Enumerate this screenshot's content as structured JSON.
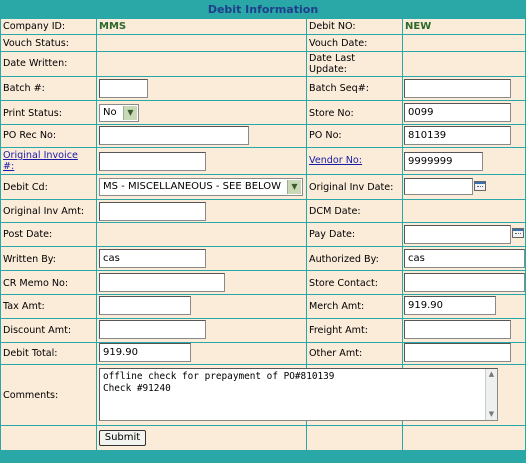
{
  "title": "Debit Information",
  "fields": {
    "company_id": {
      "label": "Company ID:",
      "value": "MMS"
    },
    "debit_no": {
      "label": "Debit NO:",
      "value": "NEW"
    },
    "vouch_status": {
      "label": "Vouch Status:"
    },
    "vouch_date": {
      "label": "Vouch Date:"
    },
    "date_written": {
      "label": "Date Written:"
    },
    "date_last_update": {
      "label_line1": "Date Last",
      "label_line2": "Update:"
    },
    "batch": {
      "label": "Batch #:",
      "value": ""
    },
    "batch_seq": {
      "label": "Batch Seq#:",
      "value": ""
    },
    "print_status": {
      "label": "Print Status:",
      "value": "No"
    },
    "store_no": {
      "label": "Store No:",
      "value": "0099"
    },
    "po_rec_no": {
      "label": "PO Rec No:",
      "value": ""
    },
    "po_no": {
      "label": "PO No:",
      "value": "810139"
    },
    "original_invoice": {
      "label_line1": "Original Invoice",
      "label_line2": "#:",
      "value": ""
    },
    "vendor_no": {
      "label": "Vendor No:",
      "value": "9999999"
    },
    "debit_cd": {
      "label": "Debit Cd:",
      "value": "MS - MISCELLANEOUS - SEE BELOW"
    },
    "original_inv_date": {
      "label": "Original Inv Date:",
      "value": ""
    },
    "original_inv_amt": {
      "label": "Original Inv Amt:",
      "value": ""
    },
    "dcm_date": {
      "label": "DCM Date:"
    },
    "post_date": {
      "label": "Post Date:"
    },
    "pay_date": {
      "label": "Pay Date:",
      "value": ""
    },
    "written_by": {
      "label": "Written By:",
      "value": "cas"
    },
    "authorized_by": {
      "label": "Authorized By:",
      "value": "cas"
    },
    "cr_memo_no": {
      "label": "CR Memo No:",
      "value": ""
    },
    "store_contact": {
      "label": "Store Contact:",
      "value": ""
    },
    "tax_amt": {
      "label": "Tax Amt:",
      "value": ""
    },
    "merch_amt": {
      "label": "Merch Amt:",
      "value": "919.90"
    },
    "discount_amt": {
      "label": "Discount Amt:",
      "value": ""
    },
    "freight_amt": {
      "label": "Freight Amt:",
      "value": ""
    },
    "debit_total": {
      "label": "Debit Total:",
      "value": "919.90"
    },
    "other_amt": {
      "label": "Other Amt:",
      "value": ""
    },
    "comments": {
      "label": "Comments:",
      "line1": "offline check for prepayment of PO#810139",
      "line2": "Check #91240"
    }
  },
  "submit_label": "Submit",
  "colors": {
    "header_bar": "#2aa7a7",
    "background": "#fbebd9",
    "title_text": "#1f3f8a",
    "value_text": "#2b6a2b",
    "link": "#1a1aa6"
  },
  "icons": {
    "calendar": "calendar-icon",
    "dropdown": "chevron-down-icon"
  }
}
